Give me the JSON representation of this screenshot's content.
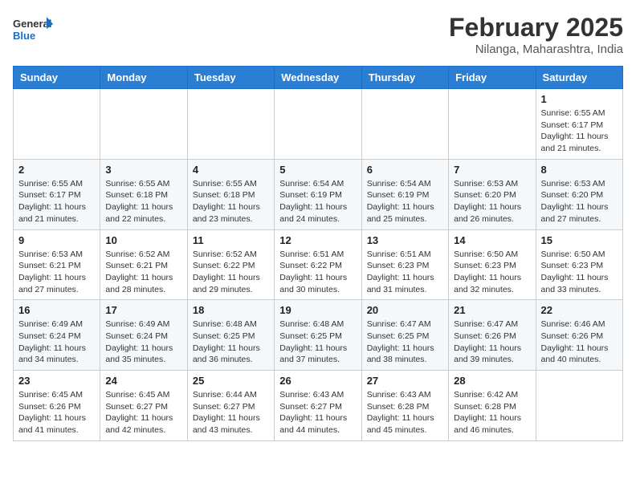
{
  "header": {
    "logo_general": "General",
    "logo_blue": "Blue",
    "month_title": "February 2025",
    "subtitle": "Nilanga, Maharashtra, India"
  },
  "weekdays": [
    "Sunday",
    "Monday",
    "Tuesday",
    "Wednesday",
    "Thursday",
    "Friday",
    "Saturday"
  ],
  "weeks": [
    [
      {
        "day": "",
        "info": ""
      },
      {
        "day": "",
        "info": ""
      },
      {
        "day": "",
        "info": ""
      },
      {
        "day": "",
        "info": ""
      },
      {
        "day": "",
        "info": ""
      },
      {
        "day": "",
        "info": ""
      },
      {
        "day": "1",
        "info": "Sunrise: 6:55 AM\nSunset: 6:17 PM\nDaylight: 11 hours\nand 21 minutes."
      }
    ],
    [
      {
        "day": "2",
        "info": "Sunrise: 6:55 AM\nSunset: 6:17 PM\nDaylight: 11 hours\nand 21 minutes."
      },
      {
        "day": "3",
        "info": "Sunrise: 6:55 AM\nSunset: 6:18 PM\nDaylight: 11 hours\nand 22 minutes."
      },
      {
        "day": "4",
        "info": "Sunrise: 6:55 AM\nSunset: 6:18 PM\nDaylight: 11 hours\nand 23 minutes."
      },
      {
        "day": "5",
        "info": "Sunrise: 6:54 AM\nSunset: 6:19 PM\nDaylight: 11 hours\nand 24 minutes."
      },
      {
        "day": "6",
        "info": "Sunrise: 6:54 AM\nSunset: 6:19 PM\nDaylight: 11 hours\nand 25 minutes."
      },
      {
        "day": "7",
        "info": "Sunrise: 6:53 AM\nSunset: 6:20 PM\nDaylight: 11 hours\nand 26 minutes."
      },
      {
        "day": "8",
        "info": "Sunrise: 6:53 AM\nSunset: 6:20 PM\nDaylight: 11 hours\nand 27 minutes."
      }
    ],
    [
      {
        "day": "9",
        "info": "Sunrise: 6:53 AM\nSunset: 6:21 PM\nDaylight: 11 hours\nand 27 minutes."
      },
      {
        "day": "10",
        "info": "Sunrise: 6:52 AM\nSunset: 6:21 PM\nDaylight: 11 hours\nand 28 minutes."
      },
      {
        "day": "11",
        "info": "Sunrise: 6:52 AM\nSunset: 6:22 PM\nDaylight: 11 hours\nand 29 minutes."
      },
      {
        "day": "12",
        "info": "Sunrise: 6:51 AM\nSunset: 6:22 PM\nDaylight: 11 hours\nand 30 minutes."
      },
      {
        "day": "13",
        "info": "Sunrise: 6:51 AM\nSunset: 6:23 PM\nDaylight: 11 hours\nand 31 minutes."
      },
      {
        "day": "14",
        "info": "Sunrise: 6:50 AM\nSunset: 6:23 PM\nDaylight: 11 hours\nand 32 minutes."
      },
      {
        "day": "15",
        "info": "Sunrise: 6:50 AM\nSunset: 6:23 PM\nDaylight: 11 hours\nand 33 minutes."
      }
    ],
    [
      {
        "day": "16",
        "info": "Sunrise: 6:49 AM\nSunset: 6:24 PM\nDaylight: 11 hours\nand 34 minutes."
      },
      {
        "day": "17",
        "info": "Sunrise: 6:49 AM\nSunset: 6:24 PM\nDaylight: 11 hours\nand 35 minutes."
      },
      {
        "day": "18",
        "info": "Sunrise: 6:48 AM\nSunset: 6:25 PM\nDaylight: 11 hours\nand 36 minutes."
      },
      {
        "day": "19",
        "info": "Sunrise: 6:48 AM\nSunset: 6:25 PM\nDaylight: 11 hours\nand 37 minutes."
      },
      {
        "day": "20",
        "info": "Sunrise: 6:47 AM\nSunset: 6:25 PM\nDaylight: 11 hours\nand 38 minutes."
      },
      {
        "day": "21",
        "info": "Sunrise: 6:47 AM\nSunset: 6:26 PM\nDaylight: 11 hours\nand 39 minutes."
      },
      {
        "day": "22",
        "info": "Sunrise: 6:46 AM\nSunset: 6:26 PM\nDaylight: 11 hours\nand 40 minutes."
      }
    ],
    [
      {
        "day": "23",
        "info": "Sunrise: 6:45 AM\nSunset: 6:26 PM\nDaylight: 11 hours\nand 41 minutes."
      },
      {
        "day": "24",
        "info": "Sunrise: 6:45 AM\nSunset: 6:27 PM\nDaylight: 11 hours\nand 42 minutes."
      },
      {
        "day": "25",
        "info": "Sunrise: 6:44 AM\nSunset: 6:27 PM\nDaylight: 11 hours\nand 43 minutes."
      },
      {
        "day": "26",
        "info": "Sunrise: 6:43 AM\nSunset: 6:27 PM\nDaylight: 11 hours\nand 44 minutes."
      },
      {
        "day": "27",
        "info": "Sunrise: 6:43 AM\nSunset: 6:28 PM\nDaylight: 11 hours\nand 45 minutes."
      },
      {
        "day": "28",
        "info": "Sunrise: 6:42 AM\nSunset: 6:28 PM\nDaylight: 11 hours\nand 46 minutes."
      },
      {
        "day": "",
        "info": ""
      }
    ]
  ]
}
